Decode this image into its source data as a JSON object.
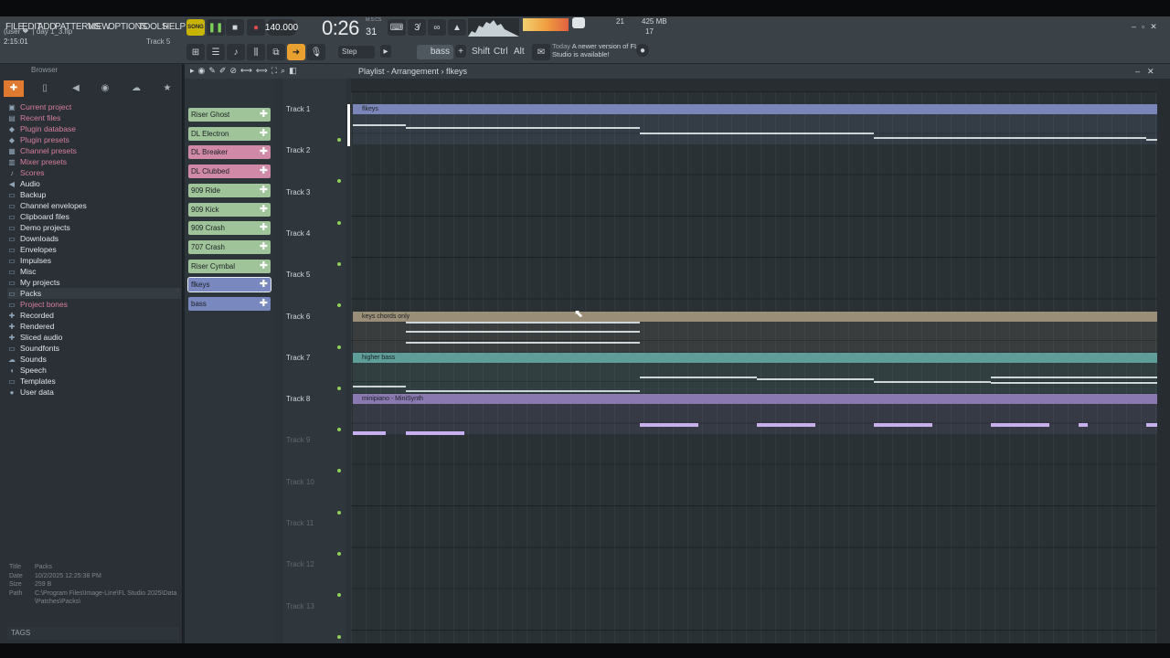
{
  "menu": [
    "FILE",
    "EDIT",
    "ADD",
    "PATTERNS",
    "VIEW",
    "OPTIONS",
    "TOOLS",
    "HELP"
  ],
  "hint": {
    "line1": "(user ❤",
    "file": "day 1_3.flp",
    "line2": "2:15:01",
    "track": "Track 5"
  },
  "transport": {
    "song_label": "SONG",
    "tempo": "140.000",
    "time": "0:26",
    "time_ms": "31",
    "msc": "M:S:CS"
  },
  "monitor": {
    "cpu": "21",
    "mem": "425 MB",
    "voices": "17"
  },
  "toolbar": {
    "step": "Step",
    "pattern": "bass",
    "shift": "Shift",
    "ctrl": "Ctrl",
    "alt": "Alt"
  },
  "news": {
    "date": "Today",
    "text": "A newer version of FL Studio is available!"
  },
  "browser": {
    "title": "Browser",
    "items": [
      {
        "label": "Current project",
        "icon": "project-icon",
        "color": "#d67fa0"
      },
      {
        "label": "Recent files",
        "icon": "recent-icon",
        "color": "#d67fa0"
      },
      {
        "label": "Plugin database",
        "icon": "plugin-icon",
        "color": "#d67fa0"
      },
      {
        "label": "Plugin presets",
        "icon": "plugin-icon",
        "color": "#d67fa0"
      },
      {
        "label": "Channel presets",
        "icon": "channel-icon",
        "color": "#d67fa0"
      },
      {
        "label": "Mixer presets",
        "icon": "mixer-icon",
        "color": "#d67fa0"
      },
      {
        "label": "Scores",
        "icon": "note-icon",
        "color": "#d67fa0"
      },
      {
        "label": "Audio",
        "icon": "speaker-icon",
        "color": "#e0e6ea"
      },
      {
        "label": "Backup",
        "icon": "folder-icon",
        "color": "#e0e6ea"
      },
      {
        "label": "Channel envelopes",
        "icon": "folder-icon",
        "color": "#e0e6ea"
      },
      {
        "label": "Clipboard files",
        "icon": "folder-icon",
        "color": "#e0e6ea"
      },
      {
        "label": "Demo projects",
        "icon": "folder-icon",
        "color": "#e0e6ea"
      },
      {
        "label": "Downloads",
        "icon": "folder-icon",
        "color": "#e0e6ea"
      },
      {
        "label": "Envelopes",
        "icon": "folder-icon",
        "color": "#e0e6ea"
      },
      {
        "label": "Impulses",
        "icon": "folder-icon",
        "color": "#e0e6ea"
      },
      {
        "label": "Misc",
        "icon": "folder-icon",
        "color": "#e0e6ea"
      },
      {
        "label": "My projects",
        "icon": "folder-icon",
        "color": "#e0e6ea"
      },
      {
        "label": "Packs",
        "icon": "folder-icon",
        "color": "#e0e6ea"
      },
      {
        "label": "Project bones",
        "icon": "folder-icon",
        "color": "#d67fa0"
      },
      {
        "label": "Recorded",
        "icon": "plus-icon",
        "color": "#e0e6ea"
      },
      {
        "label": "Rendered",
        "icon": "plus-icon",
        "color": "#e0e6ea"
      },
      {
        "label": "Sliced audio",
        "icon": "plus-icon",
        "color": "#e0e6ea"
      },
      {
        "label": "Soundfonts",
        "icon": "folder-icon",
        "color": "#e0e6ea"
      },
      {
        "label": "Sounds",
        "icon": "cloud-icon",
        "color": "#e0e6ea"
      },
      {
        "label": "Speech",
        "icon": "speech-icon",
        "color": "#e0e6ea"
      },
      {
        "label": "Templates",
        "icon": "folder-icon",
        "color": "#e0e6ea"
      },
      {
        "label": "User data",
        "icon": "user-icon",
        "color": "#e0e6ea"
      }
    ],
    "info": {
      "title_k": "Title",
      "title_v": "Packs",
      "date_k": "Date",
      "date_v": "10/2/2025 12:25:38 PM",
      "size_k": "Size",
      "size_v": "259 B",
      "path_k": "Path",
      "path_v": "C:\\Program Files\\Image-Line\\FL Studio 2025\\Data\\Patches\\Packs\\"
    },
    "tags": "TAGS"
  },
  "playlist": {
    "title": "Playlist - Arrangement",
    "pattern": "flkeys",
    "patterns": [
      {
        "label": "Riser Ghost",
        "color": "#9fc49a"
      },
      {
        "label": "DL Electron",
        "color": "#9fc49a"
      },
      {
        "label": "DL Breaker",
        "color": "#d08aa8"
      },
      {
        "label": "DL Clubbed",
        "color": "#d08aa8"
      },
      {
        "label": "909 Ride",
        "color": "#9fc49a"
      },
      {
        "label": "909 Kick",
        "color": "#9fc49a"
      },
      {
        "label": "909 Crash",
        "color": "#9fc49a"
      },
      {
        "label": "707 Crash",
        "color": "#9fc49a"
      },
      {
        "label": "Riser Cymbal",
        "color": "#9fc49a"
      },
      {
        "label": "flkeys",
        "color": "#7a88c0"
      },
      {
        "label": "bass",
        "color": "#7a88c0"
      }
    ],
    "tracks": [
      "Track 1",
      "Track 2",
      "Track 3",
      "Track 4",
      "Track 5",
      "Track 6",
      "Track 7",
      "Track 8",
      "Track 9",
      "Track 10",
      "Track 11",
      "Track 12",
      "Track 13"
    ],
    "clips": [
      {
        "label": "flkeys",
        "track": 0,
        "color": "#7b86b8"
      },
      {
        "label": "keys chords only",
        "track": 5,
        "color": "#9a8e78"
      },
      {
        "label": "higher bass",
        "track": 6,
        "color": "#5f9e98"
      },
      {
        "label": "minipiano - MiniSynth",
        "track": 7,
        "color": "#8a78b0"
      }
    ]
  }
}
